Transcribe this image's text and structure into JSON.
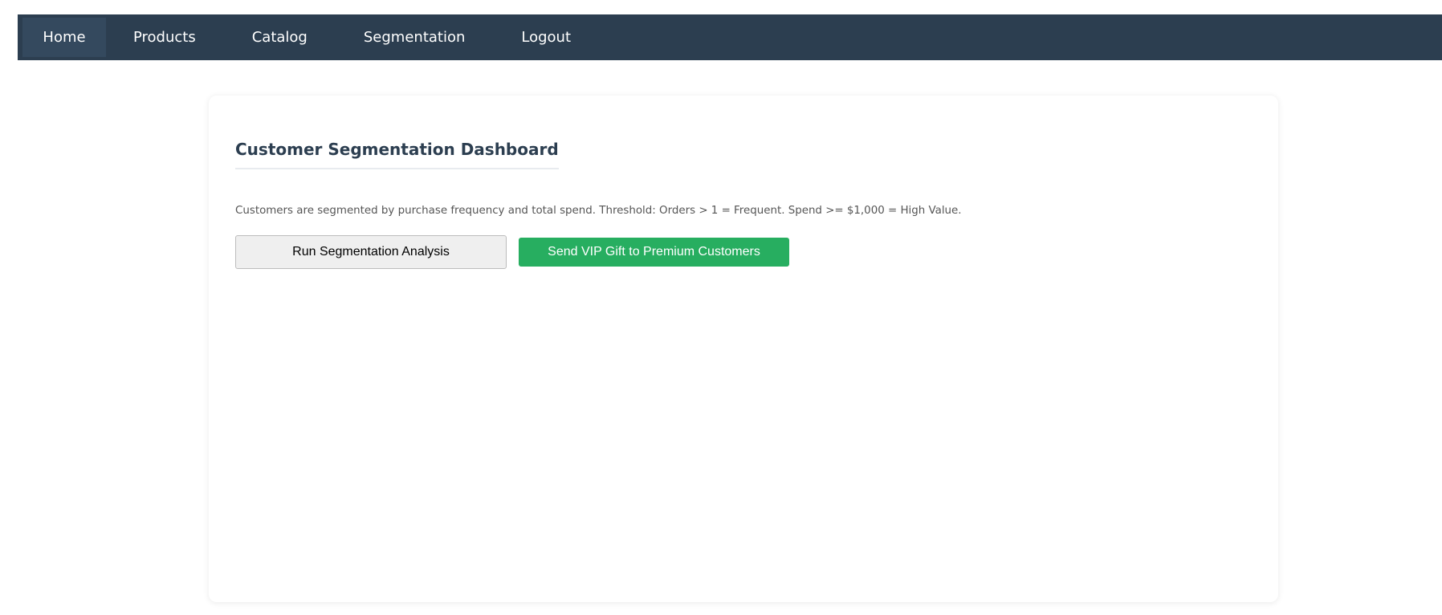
{
  "nav": {
    "items": [
      {
        "label": "Home",
        "active": true
      },
      {
        "label": "Products",
        "active": false
      },
      {
        "label": "Catalog",
        "active": false
      },
      {
        "label": "Segmentation",
        "active": false
      },
      {
        "label": "Logout",
        "active": false
      }
    ]
  },
  "dashboard": {
    "title": "Customer Segmentation Dashboard",
    "description": "Customers are segmented by purchase frequency and total spend. Threshold: Orders > 1 = Frequent. Spend >= $1,000 = High Value.",
    "run_button_label": "Run Segmentation Analysis",
    "gift_button_label": "Send VIP Gift to Premium Customers"
  },
  "colors": {
    "navbar_bg": "#2c3e50",
    "nav_active_bg": "#34495e",
    "gift_button_bg": "#27ae60",
    "title_color": "#2c3e50"
  }
}
